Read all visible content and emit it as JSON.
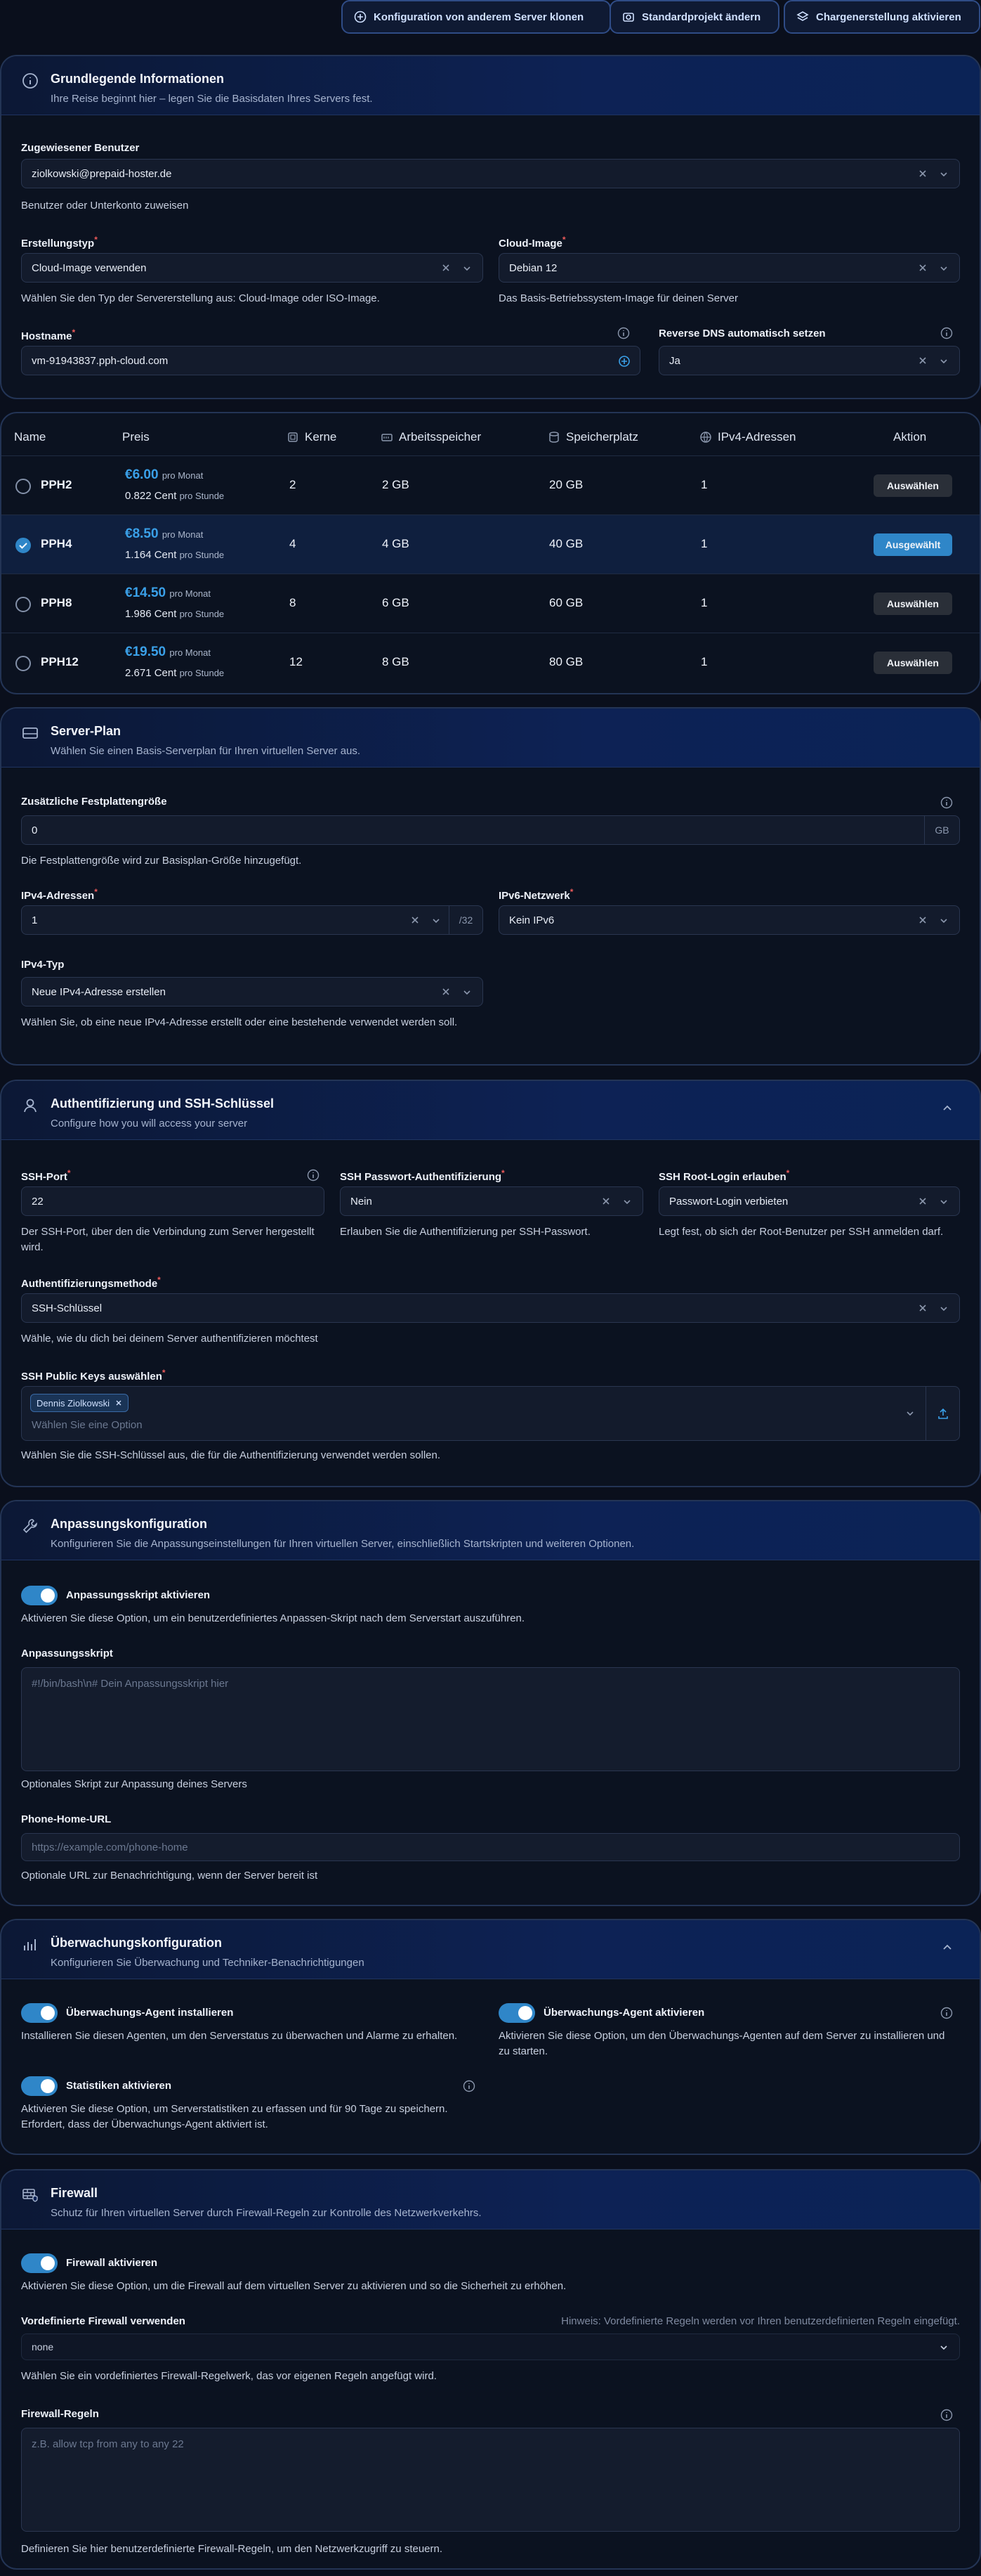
{
  "top_buttons": [
    {
      "label": "Konfiguration von anderem Server klonen"
    },
    {
      "label": "Standardprojekt ändern"
    },
    {
      "label": "Chargenerstellung aktivieren"
    }
  ],
  "basic": {
    "title": "Grundlegende Informationen",
    "subtitle": "Ihre Reise beginnt hier – legen Sie die Basisdaten Ihres Servers fest.",
    "user_label": "Zugewiesener Benutzer",
    "user_value": "ziolkowski@prepaid-hoster.de",
    "user_hint": "Benutzer oder Unterkonto zuweisen",
    "type_label": "Erstellungstyp",
    "type_value": "Cloud-Image verwenden",
    "type_hint": "Wählen Sie den Typ der Servererstellung aus: Cloud-Image oder ISO-Image.",
    "image_label": "Cloud-Image",
    "image_value": "Debian 12",
    "image_hint": "Das Basis-Betriebssystem-Image für deinen Server",
    "hostname_label": "Hostname",
    "hostname_value": "vm-91943837.pph-cloud.com",
    "rdns_label": "Reverse DNS automatisch setzen",
    "rdns_value": "Ja"
  },
  "plans": {
    "headers": {
      "name": "Name",
      "price": "Preis",
      "cores": "Kerne",
      "ram": "Arbeitsspeicher",
      "disk": "Speicherplatz",
      "ipv4": "IPv4-Adressen",
      "action": "Aktion"
    },
    "per_month": "pro Monat",
    "per_hour": "pro Stunde",
    "rows": [
      {
        "name": "PPH2",
        "price": "€6.00",
        "cent": "0.822 Cent",
        "cores": "2",
        "ram": "2 GB",
        "disk": "20 GB",
        "ipv4": "1",
        "action": "Auswählen",
        "selected": false
      },
      {
        "name": "PPH4",
        "price": "€8.50",
        "cent": "1.164 Cent",
        "cores": "4",
        "ram": "4 GB",
        "disk": "40 GB",
        "ipv4": "1",
        "action": "Ausgewählt",
        "selected": true
      },
      {
        "name": "PPH8",
        "price": "€14.50",
        "cent": "1.986 Cent",
        "cores": "8",
        "ram": "6 GB",
        "disk": "60 GB",
        "ipv4": "1",
        "action": "Auswählen",
        "selected": false
      },
      {
        "name": "PPH12",
        "price": "€19.50",
        "cent": "2.671 Cent",
        "cores": "12",
        "ram": "8 GB",
        "disk": "80 GB",
        "ipv4": "1",
        "action": "Auswählen",
        "selected": false
      }
    ]
  },
  "server_plan": {
    "title": "Server-Plan",
    "subtitle": "Wählen Sie einen Basis-Serverplan für Ihren virtuellen Server aus.",
    "disk_label": "Zusätzliche Festplattengröße",
    "disk_value": "0",
    "disk_unit": "GB",
    "disk_hint": "Die Festplattengröße wird zur Basisplan-Größe hinzugefügt.",
    "ipv4_label": "IPv4-Adressen",
    "ipv4_value": "1",
    "ipv4_suffix": "/32",
    "ipv6_label": "IPv6-Netzwerk",
    "ipv6_value": "Kein IPv6",
    "ipv4type_label": "IPv4-Typ",
    "ipv4type_value": "Neue IPv4-Adresse erstellen",
    "ipv4type_hint": "Wählen Sie, ob eine neue IPv4-Adresse erstellt oder eine bestehende verwendet werden soll."
  },
  "auth": {
    "title": "Authentifizierung und SSH-Schlüssel",
    "subtitle": "Configure how you will access your server",
    "port_label": "SSH-Port",
    "port_value": "22",
    "port_hint": "Der SSH-Port, über den die Verbindung zum Server hergestellt wird.",
    "pw_label": "SSH Passwort-Authentifizierung",
    "pw_value": "Nein",
    "pw_hint": "Erlauben Sie die Authentifizierung per SSH-Passwort.",
    "root_label": "SSH Root-Login erlauben",
    "root_value": "Passwort-Login verbieten",
    "root_hint": "Legt fest, ob sich der Root-Benutzer per SSH anmelden darf.",
    "method_label": "Authentifizierungsmethode",
    "method_value": "SSH-Schlüssel",
    "method_hint": "Wähle, wie du dich bei deinem Server authentifizieren möchtest",
    "keys_label": "SSH Public Keys auswählen",
    "key_chip": "Dennis Ziolkowski",
    "keys_placeholder": "Wählen Sie eine Option",
    "keys_hint": "Wählen Sie die SSH-Schlüssel aus, die für die Authentifizierung verwendet werden sollen."
  },
  "custom": {
    "title": "Anpassungskonfiguration",
    "subtitle": "Konfigurieren Sie die Anpassungseinstellungen für Ihren virtuellen Server, einschließlich Startskripten und weiteren Optionen.",
    "toggle_label": "Anpassungsskript aktivieren",
    "toggle_hint": "Aktivieren Sie diese Option, um ein benutzerdefiniertes Anpassen-Skript nach dem Serverstart auszuführen.",
    "script_label": "Anpassungsskript",
    "script_placeholder": "#!/bin/bash\\n# Dein Anpassungsskript hier",
    "script_hint": "Optionales Skript zur Anpassung deines Servers",
    "phone_label": "Phone-Home-URL",
    "phone_placeholder": "https://example.com/phone-home",
    "phone_hint": "Optionale URL zur Benachrichtigung, wenn der Server bereit ist"
  },
  "monitoring": {
    "title": "Überwachungskonfiguration",
    "subtitle": "Konfigurieren Sie Überwachung und Techniker-Benachrichtigungen",
    "agent_install_label": "Überwachungs-Agent installieren",
    "agent_install_hint": "Installieren Sie diesen Agenten, um den Serverstatus zu überwachen und Alarme zu erhalten.",
    "agent_enable_label": "Überwachungs-Agent aktivieren",
    "agent_enable_hint": "Aktivieren Sie diese Option, um den Überwachungs-Agenten auf dem Server zu installieren und zu starten.",
    "stats_label": "Statistiken aktivieren",
    "stats_hint": "Aktivieren Sie diese Option, um Serverstatistiken zu erfassen und für 90 Tage zu speichern. Erfordert, dass der Überwachungs-Agent aktiviert ist."
  },
  "firewall": {
    "title": "Firewall",
    "subtitle": "Schutz für Ihren virtuellen Server durch Firewall-Regeln zur Kontrolle des Netzwerkverkehrs.",
    "toggle_label": "Firewall aktivieren",
    "toggle_hint": "Aktivieren Sie diese Option, um die Firewall auf dem virtuellen Server zu aktivieren und so die Sicherheit zu erhöhen.",
    "predef_label": "Vordefinierte Firewall verwenden",
    "predef_note": "Hinweis: Vordefinierte Regeln werden vor Ihren benutzerdefinierten Regeln eingefügt.",
    "predef_value": "none",
    "predef_hint": "Wählen Sie ein vordefiniertes Firewall-Regelwerk, das vor eigenen Regeln angefügt wird.",
    "rules_label": "Firewall-Regeln",
    "rules_placeholder": "z.B. allow tcp from any to any 22",
    "rules_hint": "Definieren Sie hier benutzerdefinierte Firewall-Regeln, um den Netzwerkzugriff zu steuern."
  }
}
